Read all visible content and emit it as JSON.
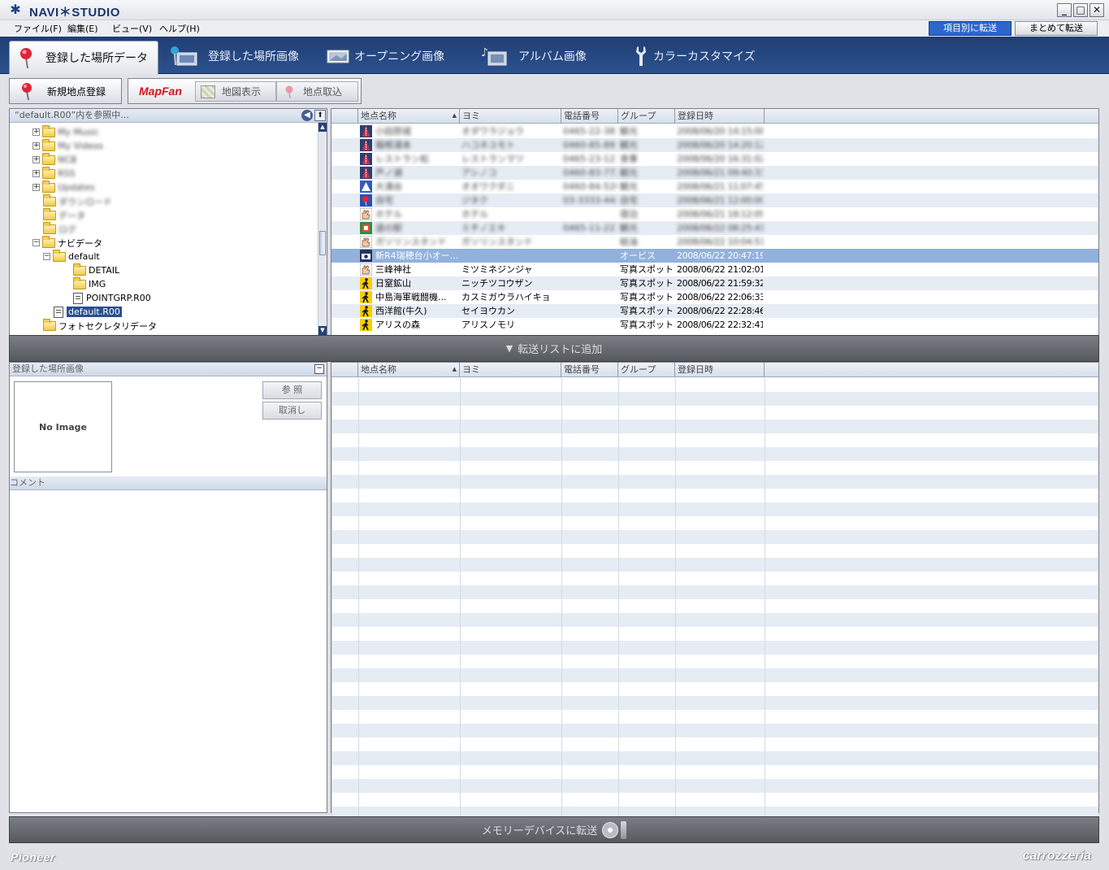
{
  "app": {
    "title": "NAVI＊STUDIO"
  },
  "menu": [
    "ファイル(F)",
    "編集(E)",
    "ビュー(V)",
    "ヘルプ(H)"
  ],
  "transfer_modes": {
    "by_item": "項目別に転送",
    "bulk": "まとめて転送"
  },
  "tabs": [
    {
      "label": "登録した場所データ",
      "icon": "pin-icon"
    },
    {
      "label": "登録した場所画像",
      "icon": "pin-photo-icon"
    },
    {
      "label": "オープニング画像",
      "icon": "image-icon"
    },
    {
      "label": "アルバム画像",
      "icon": "album-icon"
    },
    {
      "label": "カラーカスタマイズ",
      "icon": "wrench-icon"
    }
  ],
  "toolbar": {
    "new_point": "新規地点登録",
    "mapfan": "MapFan",
    "map_view": "地図表示",
    "point_import": "地点取込"
  },
  "tree": {
    "header": "“default.R00”内を参照中...",
    "items": [
      {
        "label": "My Music",
        "level": 1,
        "expander": "+",
        "kind": "folder",
        "blurred": true
      },
      {
        "label": "My Videos",
        "level": 1,
        "expander": "+",
        "kind": "folder",
        "blurred": true
      },
      {
        "label": "NCB",
        "level": 1,
        "expander": "+",
        "kind": "folder",
        "blurred": true
      },
      {
        "label": "RSS",
        "level": 1,
        "expander": "+",
        "kind": "folder",
        "blurred": true
      },
      {
        "label": "Updates",
        "level": 1,
        "expander": "+",
        "kind": "folder",
        "blurred": true
      },
      {
        "label": "ダウンロード",
        "level": 1,
        "expander": "",
        "kind": "folder",
        "blurred": true
      },
      {
        "label": "データ",
        "level": 1,
        "expander": "",
        "kind": "folder",
        "blurred": true
      },
      {
        "label": "ログ",
        "level": 1,
        "expander": "",
        "kind": "folder",
        "blurred": true
      },
      {
        "label": "ナビデータ",
        "level": 1,
        "expander": "−",
        "kind": "folder",
        "blurred": false
      },
      {
        "label": "default",
        "level": 2,
        "expander": "−",
        "kind": "folder",
        "blurred": false
      },
      {
        "label": "DETAIL",
        "level": 3,
        "expander": "",
        "kind": "folder",
        "blurred": false
      },
      {
        "label": "IMG",
        "level": 3,
        "expander": "",
        "kind": "folder",
        "blurred": false
      },
      {
        "label": "POINTGRP.R00",
        "level": 3,
        "expander": "",
        "kind": "file",
        "blurred": false
      },
      {
        "label": "default.R00",
        "level": 2,
        "expander": "",
        "kind": "file",
        "blurred": false,
        "selected": true
      },
      {
        "label": "フォトセクレタリデータ",
        "level": 1,
        "expander": "",
        "kind": "folder",
        "blurred": false
      }
    ]
  },
  "columns": [
    "地点名称",
    "ヨミ",
    "電話番号",
    "グループ",
    "登録日時"
  ],
  "points": [
    {
      "name": "小田原城",
      "yomi": "オダワラジョウ",
      "tel": "0465-22-3818",
      "group": "観光",
      "date": "2008/06/20 14:15:08",
      "icon": "road-icon",
      "blurred": true
    },
    {
      "name": "箱根湯本",
      "yomi": "ハコネユモト",
      "tel": "0460-85-8911",
      "group": "観光",
      "date": "2008/06/20 14:20:12",
      "icon": "road-icon",
      "blurred": true
    },
    {
      "name": "レストラン松",
      "yomi": "レストランマツ",
      "tel": "0465-23-1234",
      "group": "食事",
      "date": "2008/06/20 16:31:02",
      "icon": "road-icon",
      "blurred": true
    },
    {
      "name": "芦ノ湖",
      "yomi": "アシノコ",
      "tel": "0460-83-7722",
      "group": "観光",
      "date": "2008/06/21 09:40:33",
      "icon": "road-icon",
      "blurred": true
    },
    {
      "name": "大涌谷",
      "yomi": "オオワクダニ",
      "tel": "0460-84-5201",
      "group": "観光",
      "date": "2008/06/21 11:07:45",
      "icon": "warning-icon",
      "blurred": true
    },
    {
      "name": "自宅",
      "yomi": "ジタク",
      "tel": "03-3333-4444",
      "group": "自宅",
      "date": "2008/06/21 12:00:00",
      "icon": "pin-icon",
      "blurred": true
    },
    {
      "name": "ホテル",
      "yomi": "ホテル",
      "tel": "",
      "group": "宿泊",
      "date": "2008/06/21 18:12:09",
      "icon": "hand-icon",
      "blurred": true
    },
    {
      "name": "道の駅",
      "yomi": "ミチノエキ",
      "tel": "0465-11-2233",
      "group": "観光",
      "date": "2008/06/22 08:25:41",
      "icon": "grid-icon",
      "blurred": true
    },
    {
      "name": "ガソリンスタンド",
      "yomi": "ガソリンスタンド",
      "tel": "",
      "group": "給油",
      "date": "2008/06/22 10:04:51",
      "icon": "hand-icon",
      "blurred": true
    },
    {
      "name": "新R4瑞穂台小オー...",
      "yomi": "",
      "tel": "",
      "group": "オービス",
      "date": "2008/06/22 20:47:19",
      "icon": "camera-icon",
      "selected": true
    },
    {
      "name": "三峰神社",
      "yomi": "ミツミネジンジャ",
      "tel": "",
      "group": "写真スポット",
      "date": "2008/06/22 21:02:01",
      "icon": "hand-icon"
    },
    {
      "name": "日窒鉱山",
      "yomi": "ニッチツコウザン",
      "tel": "",
      "group": "写真スポット",
      "date": "2008/06/22 21:59:32",
      "icon": "hiker-icon"
    },
    {
      "name": "中島海軍戦闘機...",
      "yomi": "カスミガウラハイキョ",
      "tel": "",
      "group": "写真スポット",
      "date": "2008/06/22 22:06:33",
      "icon": "hiker-icon"
    },
    {
      "name": "西洋館(牛久)",
      "yomi": "セイヨウカン",
      "tel": "",
      "group": "写真スポット",
      "date": "2008/06/22 22:28:46",
      "icon": "hiker-icon"
    },
    {
      "name": "アリスの森",
      "yomi": "アリスノモリ",
      "tel": "",
      "group": "写真スポット",
      "date": "2008/06/22 22:32:41",
      "icon": "hiker-icon"
    }
  ],
  "add_to_transfer": "転送リストに追加",
  "image_panel": {
    "header": "登録した場所画像",
    "no_image": "No Image",
    "browse": "参 照",
    "cancel": "取消し",
    "comment": "コメント"
  },
  "transfer_to_device": "メモリーデバイスに転送",
  "brands": {
    "left": "Pioneer",
    "right": "carrozzeria"
  },
  "colors": {
    "tabbar": "#2c518d",
    "selection": "#92b1dc",
    "accent": "#2e66cc"
  }
}
